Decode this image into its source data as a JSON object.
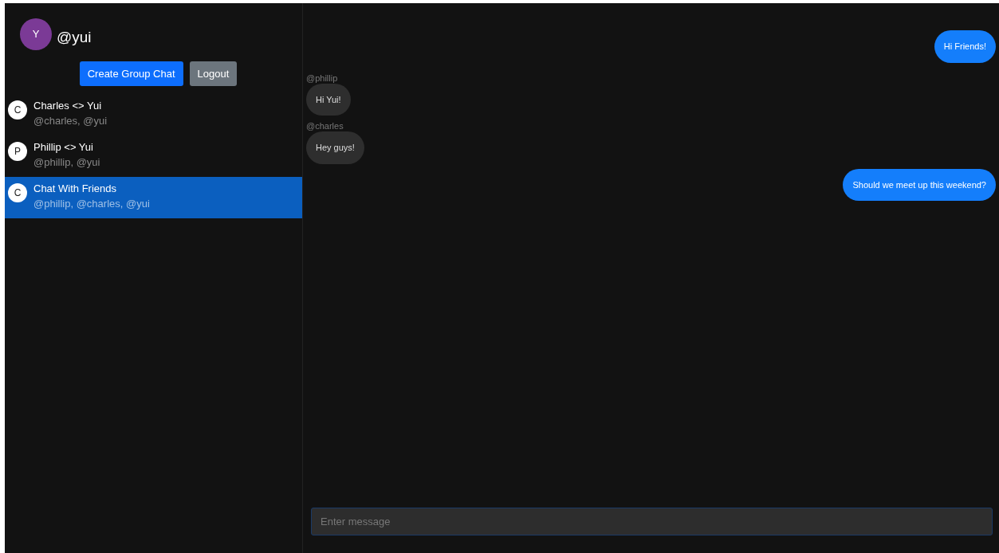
{
  "user": {
    "avatar": "Y",
    "color": "#7b3a96",
    "handle": "@yui"
  },
  "buttons": [
    {
      "label": "Create Group Chat",
      "kind": "primary"
    },
    {
      "label": "Logout",
      "kind": "secondary"
    }
  ],
  "chats": [
    {
      "avatar": "C",
      "title": "Charles <> Yui",
      "members": "@charles, @yui",
      "selected": false
    },
    {
      "avatar": "P",
      "title": "Phillip <> Yui",
      "members": "@phillip, @yui",
      "selected": false
    },
    {
      "avatar": "C",
      "title": "Chat With Friends",
      "members": "@phillip, @charles, @yui",
      "selected": true
    }
  ],
  "messages": [
    {
      "kind": "outgoing",
      "text": "Hi Friends!"
    },
    {
      "kind": "incoming",
      "sender": "@phillip",
      "text": "Hi Yui!"
    },
    {
      "kind": "incoming",
      "sender": "@charles",
      "text": "Hey guys!"
    },
    {
      "kind": "outgoing",
      "text": "Should we meet up this weekend?"
    }
  ],
  "composer": {
    "placeholder": "Enter message"
  }
}
